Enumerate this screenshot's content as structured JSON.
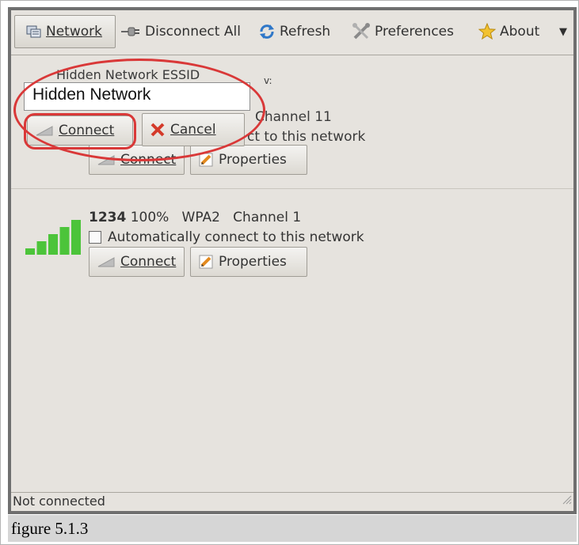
{
  "toolbar": {
    "network_label": "Network",
    "disconnect_label": "Disconnect All",
    "refresh_label": "Refresh",
    "preferences_label": "Preferences",
    "about_label": "About",
    "more_icon": "triangle-down-icon"
  },
  "hidden_dialog": {
    "label": "Hidden Network ESSID",
    "partial_label": "v:",
    "input_value": "Hidden Network",
    "connect_label": "Connect",
    "cancel_label": "Cancel"
  },
  "networks": [
    {
      "info": "Channel 11",
      "auto_text": "ct to this network",
      "connect_label": "Connect",
      "properties_label": "Properties"
    },
    {
      "essid": "1234",
      "info": "100%   WPA2   Channel 1",
      "auto_text": "Automatically connect to this network",
      "connect_label": "Connect",
      "properties_label": "Properties",
      "signal_fraction": 1.0
    }
  ],
  "status_text": "Not connected",
  "caption": "figure 5.1.3",
  "colors": {
    "highlight": "#d93838",
    "signal": "#4cc43a",
    "window_bg": "#e6e3de"
  }
}
